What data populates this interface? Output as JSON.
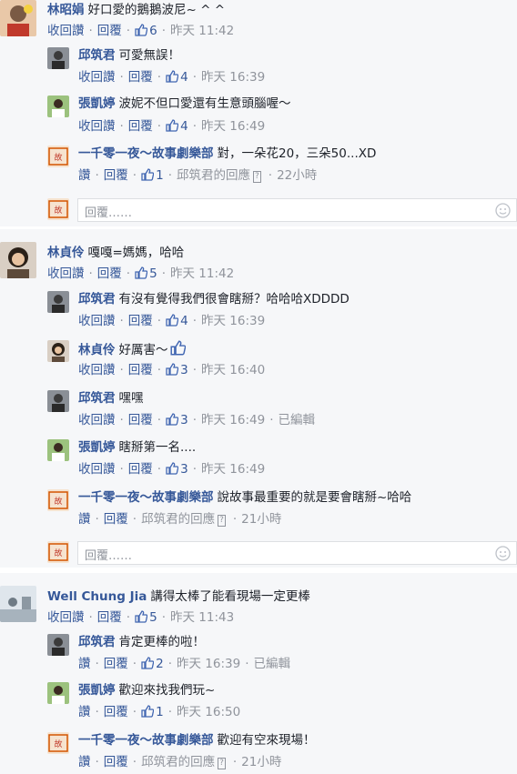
{
  "icons": {
    "like": "thumbs-up-icon",
    "emoji": "smile-icon"
  },
  "threads": [
    {
      "comment": {
        "name": "林昭娟",
        "text": "好口愛的鵝鵝波尼~ ^ ^",
        "unlike": "收回讚",
        "reply": "回覆",
        "likes": "6",
        "time": "昨天 11:42"
      },
      "replies": [
        {
          "name": "邱筑君",
          "text": "可愛無誤！",
          "unlike": "收回讚",
          "reply": "回覆",
          "likes": "4",
          "time": "昨天 16:39"
        },
        {
          "name": "張凱婷",
          "text": "波妮不但口愛還有生意頭腦喔～",
          "unlike": "收回讚",
          "reply": "回覆",
          "likes": "4",
          "time": "昨天 16:49"
        },
        {
          "name": "一千零一夜～故事劇樂部",
          "text": "對，一朵花20，三朵50...XD",
          "like": "讚",
          "reply": "回覆",
          "likes": "1",
          "reply_to": "邱筑君的回應",
          "time": "22小時"
        }
      ],
      "reply_placeholder": "回覆……"
    },
    {
      "comment": {
        "name": "林貞伶",
        "text": "嘎嘎=媽媽，哈哈",
        "unlike": "收回讚",
        "reply": "回覆",
        "likes": "5",
        "time": "昨天 11:42"
      },
      "replies": [
        {
          "name": "邱筑君",
          "text": "有沒有覺得我們很會瞎掰？哈哈哈XDDDD",
          "unlike": "收回讚",
          "reply": "回覆",
          "likes": "4",
          "time": "昨天 16:39"
        },
        {
          "name": "林貞伶",
          "text": "好厲害～",
          "unlike": "收回讚",
          "reply": "回覆",
          "likes": "3",
          "time": "昨天 16:40"
        },
        {
          "name": "邱筑君",
          "text": "嘿嘿",
          "unlike": "收回讚",
          "reply": "回覆",
          "likes": "3",
          "time": "昨天 16:49",
          "edited": "已編輯"
        },
        {
          "name": "張凱婷",
          "text": "瞎掰第一名....",
          "unlike": "收回讚",
          "reply": "回覆",
          "likes": "3",
          "time": "昨天 16:49"
        },
        {
          "name": "一千零一夜～故事劇樂部",
          "text": "說故事最重要的就是要會瞎掰~哈哈",
          "like": "讚",
          "reply": "回覆",
          "reply_to": "邱筑君的回應",
          "time": "21小時"
        }
      ],
      "reply_placeholder": "回覆……"
    },
    {
      "comment": {
        "name": "Well Chung Jia",
        "text": "講得太棒了能看現場一定更棒",
        "unlike": "收回讚",
        "reply": "回覆",
        "likes": "5",
        "time": "昨天 11:43"
      },
      "replies": [
        {
          "name": "邱筑君",
          "text": "肯定更棒的啦！",
          "like": "讚",
          "reply": "回覆",
          "likes": "2",
          "time": "昨天 16:39",
          "edited": "已編輯"
        },
        {
          "name": "張凱婷",
          "text": "歡迎來找我們玩~",
          "like": "讚",
          "reply": "回覆",
          "likes": "1",
          "time": "昨天 16:50"
        },
        {
          "name": "一千零一夜～故事劇樂部",
          "text": "歡迎有空來現場！",
          "like": "讚",
          "reply": "回覆",
          "reply_to": "邱筑君的回應",
          "time": "21小時"
        }
      ]
    }
  ]
}
